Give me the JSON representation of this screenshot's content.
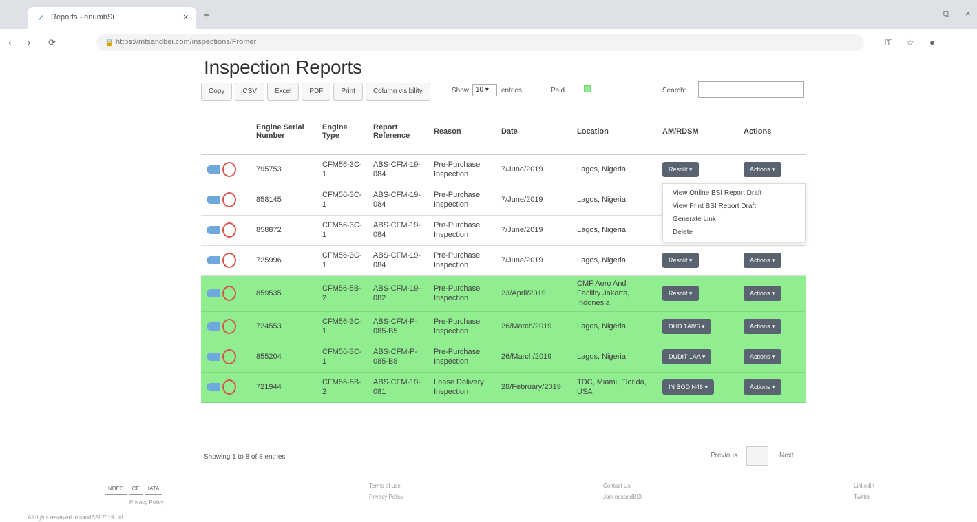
{
  "browser": {
    "tab_title": "Reports - enumbSi",
    "url": "https://mtsandbei.com/inspections/Fromer",
    "window_controls": [
      "–",
      "⧉",
      "×"
    ],
    "nav": [
      "‹",
      "›",
      "⟳"
    ]
  },
  "page": {
    "title": "Inspection Reports"
  },
  "toolbar": {
    "buttons": [
      "Copy",
      "CSV",
      "Excel",
      "PDF",
      "Print",
      "Column visibility"
    ],
    "show_label": "Show",
    "page_size": "10",
    "entries_label": "entries",
    "paid_label": "Paid",
    "search_label": "Search:",
    "search_value": ""
  },
  "table": {
    "headers": [
      "",
      "Engine Serial Number",
      "Engine Type",
      "Report Reference",
      "Reason",
      "Date",
      "Location",
      "AM/RDSM",
      "Actions"
    ],
    "rows": [
      {
        "serial": "795753",
        "type": "CFM56-3C-1",
        "ref": "ABS-CFM-19-084",
        "reason": "Pre-Purchase Inspection",
        "date": "7/June/2019",
        "location": "Lagos, Nigeria",
        "status": "Resolit ▾",
        "actions": "Actions ▾",
        "paid": false
      },
      {
        "serial": "858145",
        "type": "CFM56-3C-1",
        "ref": "ABS-CFM-19-084",
        "reason": "Pre-Purchase Inspection",
        "date": "7/June/2019",
        "location": "Lagos, Nigeria",
        "status": "",
        "actions": "",
        "paid": false
      },
      {
        "serial": "858872",
        "type": "CFM56-3C-1",
        "ref": "ABS-CFM-19-084",
        "reason": "Pre-Purchase Inspection",
        "date": "7/June/2019",
        "location": "Lagos, Nigeria",
        "status": "",
        "actions": "",
        "paid": false
      },
      {
        "serial": "725996",
        "type": "CFM56-3C-1",
        "ref": "ABS-CFM-19-084",
        "reason": "Pre-Purchase Inspection",
        "date": "7/June/2019",
        "location": "Lagos, Nigeria",
        "status": "Resolit ▾",
        "actions": "Actions ▾",
        "paid": false
      },
      {
        "serial": "859535",
        "type": "CFM56-5B-2",
        "ref": "ABS-CFM-19-082",
        "reason": "Pre-Purchase Inspection",
        "date": "23/April/2019",
        "location": "CMF Aero And Facility Jakarta, Indonesia",
        "status": "Resolit ▾",
        "actions": "Actions ▾",
        "paid": true,
        "tall": true
      },
      {
        "serial": "724553",
        "type": "CFM56-3C-1",
        "ref": "ABS-CFM-P-085-B5",
        "reason": "Pre-Purchase Inspection",
        "date": "26/March/2019",
        "location": "Lagos, Nigeria",
        "status": "DHD 1A8/6 ▾",
        "actions": "Actions ▾",
        "paid": true
      },
      {
        "serial": "855204",
        "type": "CFM56-3C-1",
        "ref": "ABS-CFM-P-085-B8",
        "reason": "Pre-Purchase Inspection",
        "date": "26/March/2019",
        "location": "Lagos, Nigeria",
        "status": "DUDIT 1AA ▾",
        "actions": "Actions ▾",
        "paid": true
      },
      {
        "serial": "721944",
        "type": "CFM56-5B-2",
        "ref": "ABS-CFM-19-081",
        "reason": "Lease Delivery Inspection",
        "date": "28/February/2019",
        "location": "TDC, Miami, Florida, USA",
        "status": "IN BOD N46 ▾",
        "actions": "Actions ▾",
        "paid": true
      }
    ]
  },
  "dropdown": {
    "items": [
      "View Online BSI Report Draft",
      "View Print BSI Report Draft",
      "Generate Link",
      "Delete"
    ]
  },
  "pagination": {
    "showing": "Showing 1 to 8 of 8 entries",
    "previous": "Previous",
    "next": "Next"
  },
  "footer": {
    "logos": [
      "NDEC",
      "CE",
      "IATA"
    ],
    "left_caption": "Privacy Policy",
    "col1": [
      "Terms of use",
      "Privacy Policy"
    ],
    "col2": [
      "Contact Us",
      "Join mtsandBSI"
    ],
    "col3": [
      "Linkedin",
      "Twitter"
    ],
    "bottom_left": "All rights reserved mtsandBSI 2019 Ltd"
  },
  "colors": {
    "paid_row": "#90ee90",
    "dark_button": "#5a6470"
  }
}
